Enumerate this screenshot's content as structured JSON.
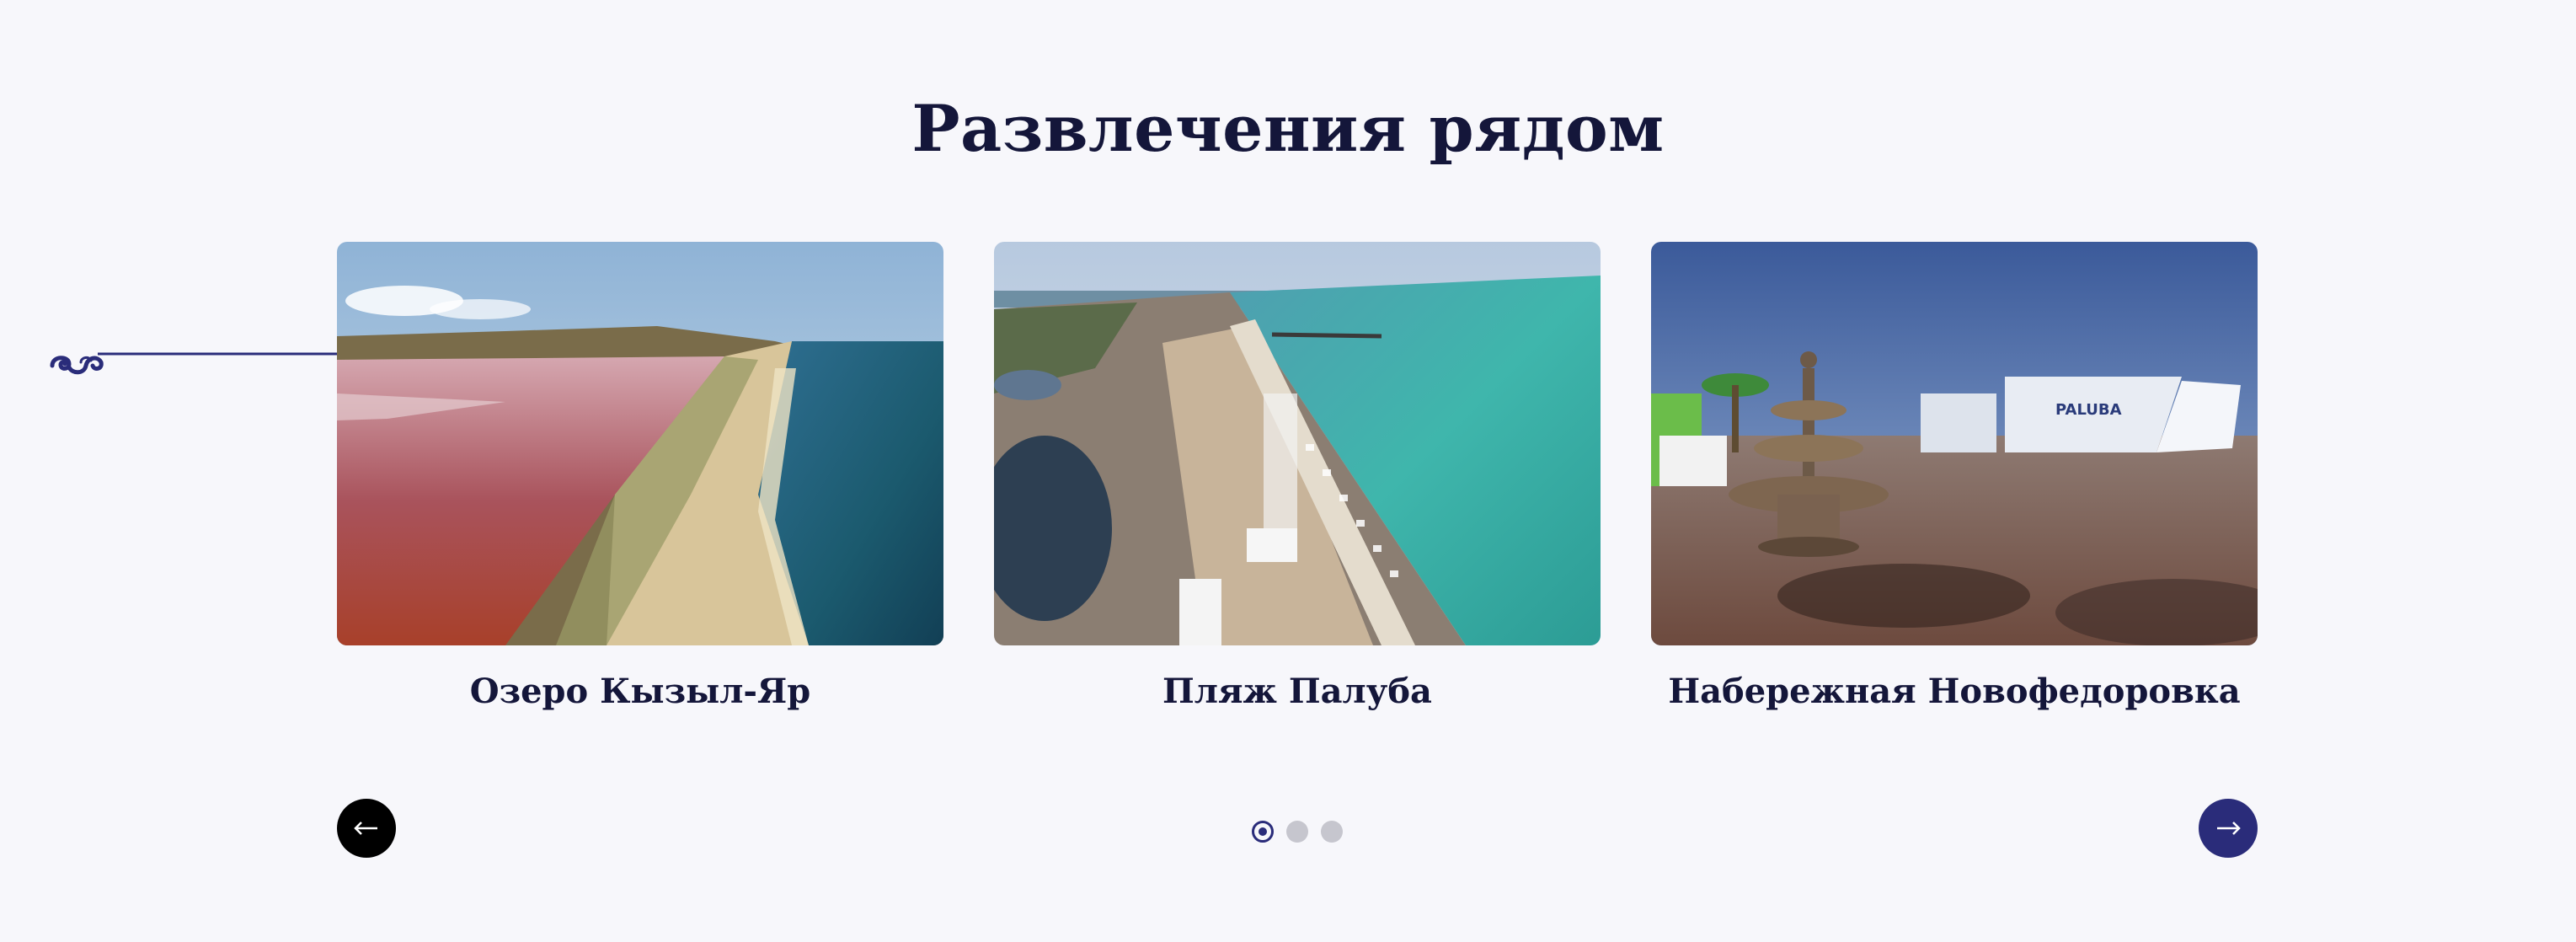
{
  "section": {
    "title": "Развлечения рядом"
  },
  "cards": [
    {
      "title": "Озеро Кызыл-Яр",
      "image": "aerial-pink-lake-and-sea-spit"
    },
    {
      "title": "Пляж Палуба",
      "image": "aerial-beach-with-turquoise-sea"
    },
    {
      "title": "Набережная Новофедоровка",
      "image": "embankment-with-fountain",
      "image_sign_text": "PALUBA"
    }
  ],
  "carousel": {
    "prev_icon": "arrow-left-icon",
    "next_icon": "arrow-right-icon",
    "page_count": 3,
    "active_page": 1
  },
  "colors": {
    "background": "#f7f7fb",
    "heading": "#14163a",
    "accent": "#2a2c7a",
    "prev_button": "#000000",
    "dot_inactive": "#c6c6ce"
  }
}
